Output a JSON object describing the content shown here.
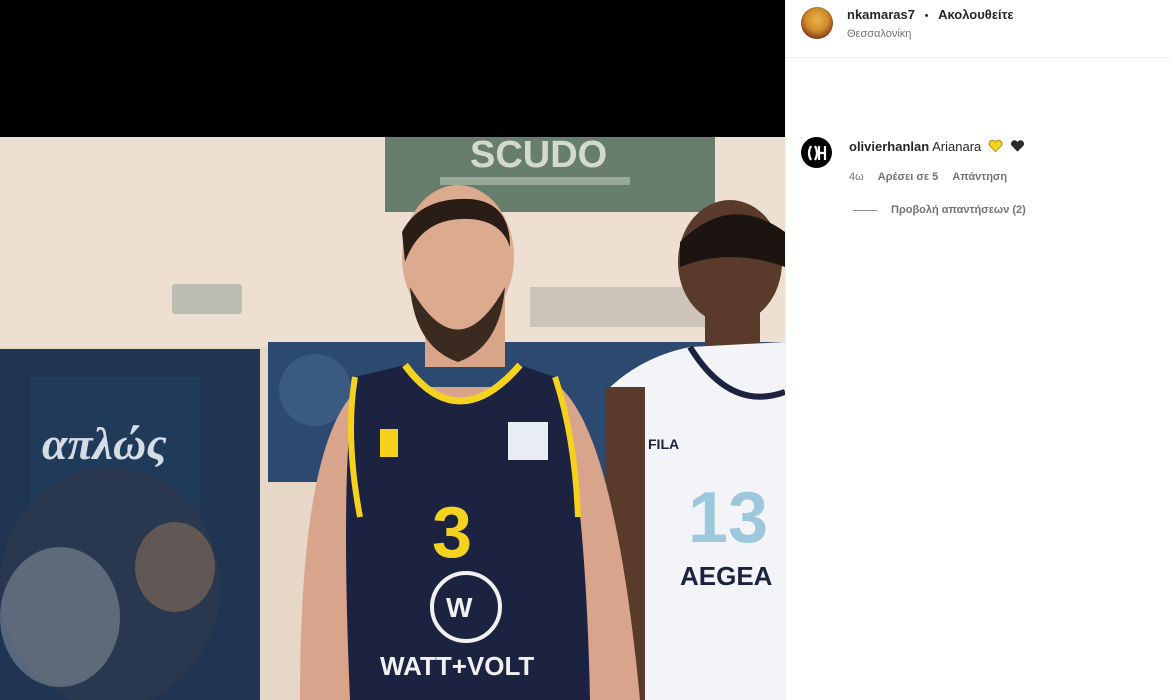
{
  "post": {
    "owner_username": "nkamaras7",
    "separator": "•",
    "follow_state": "Ακολουθείτε",
    "location": "Θεσσαλονίκη"
  },
  "media": {
    "background_banner_text": "SCUDO",
    "left_banner_text": "απλώς",
    "jersey_number_main": "3",
    "jersey_sponsor": "WATT+VOLT",
    "jersey_number_second": "13",
    "second_jersey_sponsor": "AEGEA",
    "second_jersey_brand": "FILA"
  },
  "comment": {
    "username": "olivierhanlan",
    "text": "Arianara",
    "emojis": [
      "yellow-heart-icon",
      "black-heart-icon"
    ],
    "time": "4ω",
    "likes": "Αρέσει σε 5",
    "reply": "Απάντηση",
    "view_replies": "Προβολή απαντήσεων (2)"
  },
  "colors": {
    "accent_yellow": "#f4d21d",
    "jersey_navy": "#1c2340",
    "muted_text": "#737373"
  }
}
